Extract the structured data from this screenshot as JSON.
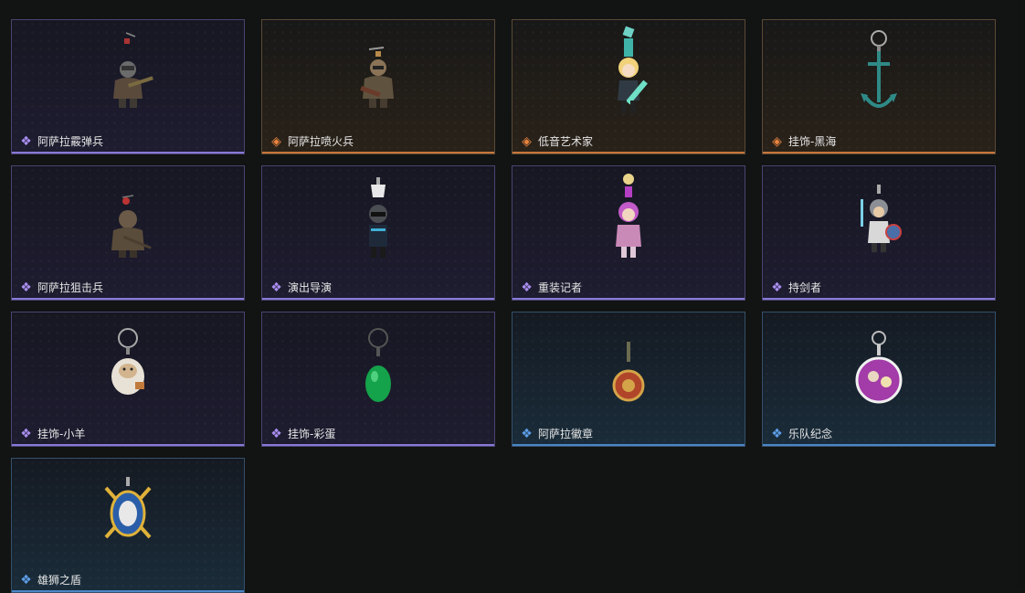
{
  "items": [
    {
      "name": "阿萨拉霰弹兵",
      "rarity": "purple",
      "icon": "soldier-shotgun-icon"
    },
    {
      "name": "阿萨拉喷火兵",
      "rarity": "orange",
      "icon": "soldier-flamethrower-icon"
    },
    {
      "name": "低音艺术家",
      "rarity": "orange",
      "icon": "bass-artist-icon"
    },
    {
      "name": "挂饰-黑海",
      "rarity": "orange",
      "icon": "anchor-charm-icon"
    },
    {
      "name": "阿萨拉狙击兵",
      "rarity": "purple",
      "icon": "soldier-sniper-icon"
    },
    {
      "name": "演出导演",
      "rarity": "purple",
      "icon": "show-director-icon"
    },
    {
      "name": "重装记者",
      "rarity": "purple",
      "icon": "heavy-reporter-icon"
    },
    {
      "name": "持剑者",
      "rarity": "purple",
      "icon": "sword-bearer-icon"
    },
    {
      "name": "挂饰-小羊",
      "rarity": "purple",
      "icon": "sheep-charm-icon"
    },
    {
      "name": "挂饰-彩蛋",
      "rarity": "purple",
      "icon": "egg-charm-icon"
    },
    {
      "name": "阿萨拉徽章",
      "rarity": "blue",
      "icon": "badge-charm-icon"
    },
    {
      "name": "乐队纪念",
      "rarity": "blue",
      "icon": "band-badge-icon"
    },
    {
      "name": "雄狮之盾",
      "rarity": "blue",
      "icon": "lion-shield-icon"
    }
  ],
  "rarity_colors": {
    "purple": "#a98ef0",
    "orange": "#e9843f",
    "blue": "#5d9ee8"
  }
}
